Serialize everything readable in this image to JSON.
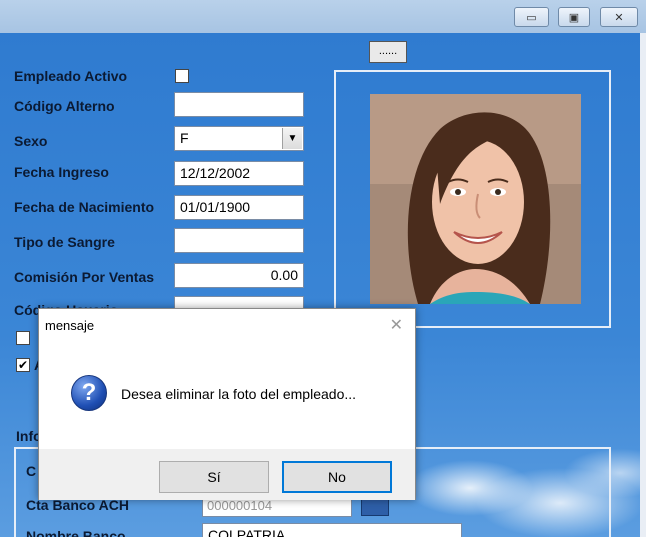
{
  "window": {
    "minimize_glyph": "▭",
    "maximize_glyph": "▣",
    "close_glyph": "✕"
  },
  "form": {
    "photo_button_label": "......",
    "fields": [
      {
        "label": "Empleado Activo",
        "type": "checkbox",
        "value": ""
      },
      {
        "label": "Código Alterno",
        "type": "text",
        "value": ""
      },
      {
        "label": "Sexo",
        "type": "combo",
        "value": "F"
      },
      {
        "label": "Fecha Ingreso",
        "type": "text",
        "value": "12/12/2002"
      },
      {
        "label": "Fecha de Nacimiento",
        "type": "text",
        "value": "01/01/1900"
      },
      {
        "label": "Tipo de Sangre",
        "type": "text",
        "value": ""
      },
      {
        "label": "Comisión Por Ventas",
        "type": "text",
        "value": "0.00"
      },
      {
        "label": "Código Usuario",
        "type": "text",
        "value": ""
      }
    ],
    "checkbox_a_mark": "",
    "checkbox_b_mark": "✔",
    "check_b_label_partial": "A",
    "group_title_partial": "Info",
    "row_c_label_partial": "C",
    "cta_label_partial": "Cta Banco ACH",
    "cta_value_partial": "000000104",
    "bank_label_partial": "Nombre Banco",
    "bank_value_partial": "COLPATRIA"
  },
  "dialog": {
    "title": "mensaje",
    "close_glyph": "✕",
    "icon": "question-icon",
    "icon_glyph": "?",
    "message": "Desea eliminar la foto del empleado...",
    "yes_label": "Sí",
    "no_label": "No"
  }
}
